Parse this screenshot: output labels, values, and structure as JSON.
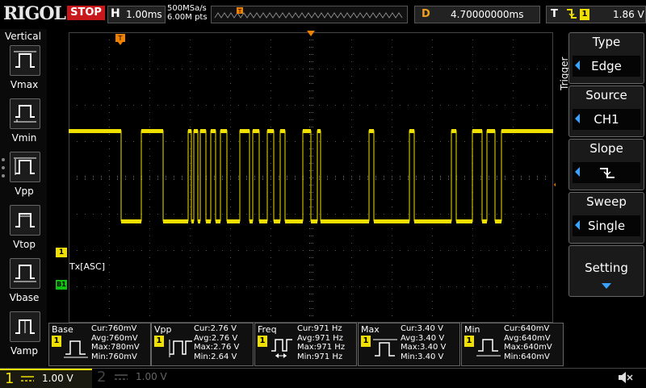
{
  "brand": {
    "logo": "RIGOL"
  },
  "status": {
    "run_state": "STOP"
  },
  "horizontal": {
    "label": "H",
    "timebase": "1.00ms",
    "sample_rate": "500MSa/s",
    "memory_depth": "6.00M pts"
  },
  "delay": {
    "label": "D",
    "value": "4.70000000ms"
  },
  "trigger_status": {
    "label": "T",
    "source_badge": "1",
    "level": "1.86 V"
  },
  "left_menu": {
    "title": "Vertical",
    "items": [
      {
        "label": "Vmax"
      },
      {
        "label": "Vmin"
      },
      {
        "label": "Vpp"
      },
      {
        "label": "Vtop"
      },
      {
        "label": "Vbase"
      },
      {
        "label": "Vamp"
      }
    ]
  },
  "waveform": {
    "decode_label": "Tx[ASC]",
    "ch1_marker": "1",
    "bus_marker": "B1",
    "trigger_marker": "T",
    "color": "#f0e000"
  },
  "trigger_menu": {
    "title": "Trigger",
    "type": {
      "label": "Type",
      "value": "Edge"
    },
    "source": {
      "label": "Source",
      "value": "CH1"
    },
    "slope": {
      "label": "Slope",
      "icon": "falling-edge-icon"
    },
    "sweep": {
      "label": "Sweep",
      "value": "Single"
    },
    "setting": {
      "label": "Setting"
    }
  },
  "measurements": [
    {
      "name": "Base",
      "badge": "1",
      "cur": "Cur:760mV",
      "avg": "Avg:760mV",
      "max": "Max:780mV",
      "min": "Min:760mV"
    },
    {
      "name": "Vpp",
      "badge": "1",
      "cur": "Cur:2.76 V",
      "avg": "Avg:2.76 V",
      "max": "Max:2.76 V",
      "min": "Min:2.64 V"
    },
    {
      "name": "Freq",
      "badge": "1",
      "cur": "Cur:971 Hz",
      "avg": "Avg:971 Hz",
      "max": "Max:971 Hz",
      "min": "Min:971 Hz"
    },
    {
      "name": "Max",
      "badge": "1",
      "cur": "Cur:3.40 V",
      "avg": "Avg:3.40 V",
      "max": "Max:3.40 V",
      "min": "Min:3.40 V"
    },
    {
      "name": "Min",
      "badge": "1",
      "cur": "Cur:640mV",
      "avg": "Avg:640mV",
      "max": "Max:640mV",
      "min": "Min:640mV"
    }
  ],
  "channels": [
    {
      "num": "1",
      "scale": "1.00 V",
      "color": "#f0e000"
    },
    {
      "num": "2",
      "scale": "1.00 V",
      "color": "#444444"
    }
  ]
}
